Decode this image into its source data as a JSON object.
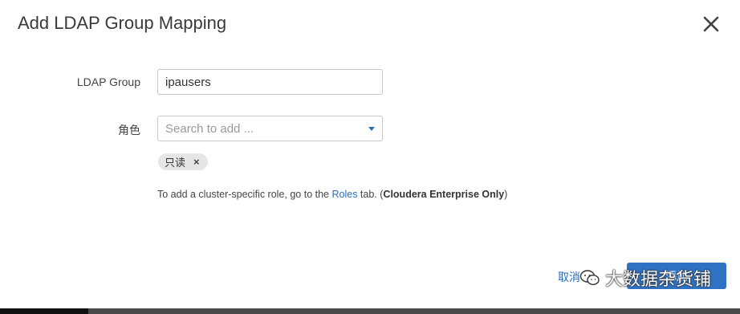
{
  "dialog": {
    "title": "Add LDAP Group Mapping"
  },
  "form": {
    "ldap_group_label": "LDAP Group",
    "ldap_group_value": "ipausers",
    "role_label": "角色",
    "role_placeholder": "Search to add ...",
    "selected_roles": [
      "只读"
    ],
    "tag_remove_symbol": "×"
  },
  "help": {
    "prefix": "To add a cluster-specific role, go to the ",
    "roles_link": "Roles",
    "middle": " tab. (",
    "bold": "Cloudera Enterprise Only",
    "suffix": ")"
  },
  "footer": {
    "cancel_label": "取消",
    "primary_label": "添加"
  },
  "watermark": {
    "text": "大数据杂货铺",
    "icon": "wechat-icon"
  },
  "icons": {
    "close": "close-icon",
    "dropdown": "caret-down-icon"
  },
  "colors": {
    "accent": "#2a6ebb",
    "primary_button": "#2f72c4",
    "tag_bg": "#e6e6e6"
  }
}
